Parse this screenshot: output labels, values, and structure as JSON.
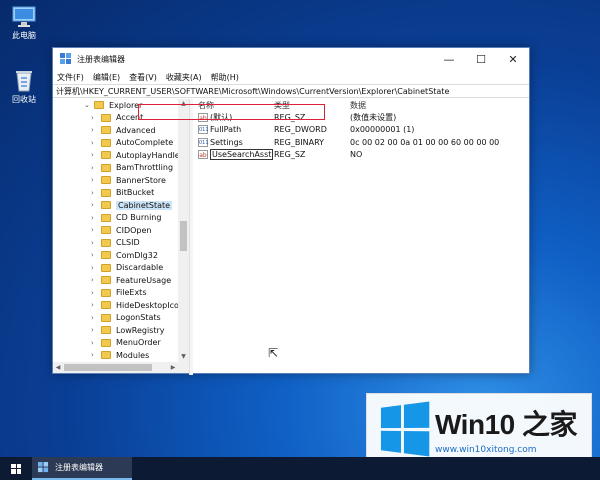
{
  "desktop": {
    "icons": [
      {
        "label": "此电脑",
        "icon": "computer-icon"
      },
      {
        "label": "回收站",
        "icon": "recycle-bin-icon"
      }
    ]
  },
  "window": {
    "title": "注册表编辑器",
    "controls": {
      "minimize": "—",
      "maximize": "☐",
      "close": "✕"
    },
    "menu": [
      "文件(F)",
      "编辑(E)",
      "查看(V)",
      "收藏夹(A)",
      "帮助(H)"
    ],
    "address": "计算机\\HKEY_CURRENT_USER\\SOFTWARE\\Microsoft\\Windows\\CurrentVersion\\Explorer\\CabinetState"
  },
  "tree": {
    "root": "Explorer",
    "items": [
      "Accent",
      "Advanced",
      "AutoComplete",
      "AutoplayHandle",
      "BamThrottling",
      "BannerStore",
      "BitBucket",
      "CabinetState",
      "CD Burning",
      "CIDOpen",
      "CLSID",
      "ComDlg32",
      "Discardable",
      "FeatureUsage",
      "FileExts",
      "HideDesktopIco",
      "LogonStats",
      "LowRegistry",
      "MenuOrder",
      "Modules"
    ],
    "selected": "CabinetState"
  },
  "list": {
    "headers": {
      "name": "名称",
      "type": "类型",
      "data": "数据"
    },
    "rows": [
      {
        "name": "(默认)",
        "type": "REG_SZ",
        "data": "(数值未设置)",
        "icon": "string"
      },
      {
        "name": "FullPath",
        "type": "REG_DWORD",
        "data": "0x00000001 (1)",
        "icon": "binary"
      },
      {
        "name": "Settings",
        "type": "REG_BINARY",
        "data": "0c 00 02 00 0a 01 00 00 60 00 00 00",
        "icon": "binary"
      },
      {
        "name": "UseSearchAsst",
        "type": "REG_SZ",
        "data": "NO",
        "icon": "string"
      }
    ],
    "highlight_color": "#e0203a"
  },
  "watermark": {
    "title": "Win10",
    "title_cn": "之家",
    "url": "www.win10xitong.com",
    "accent": "#1696e6"
  },
  "taskbar": {
    "app_label": "注册表编辑器"
  }
}
